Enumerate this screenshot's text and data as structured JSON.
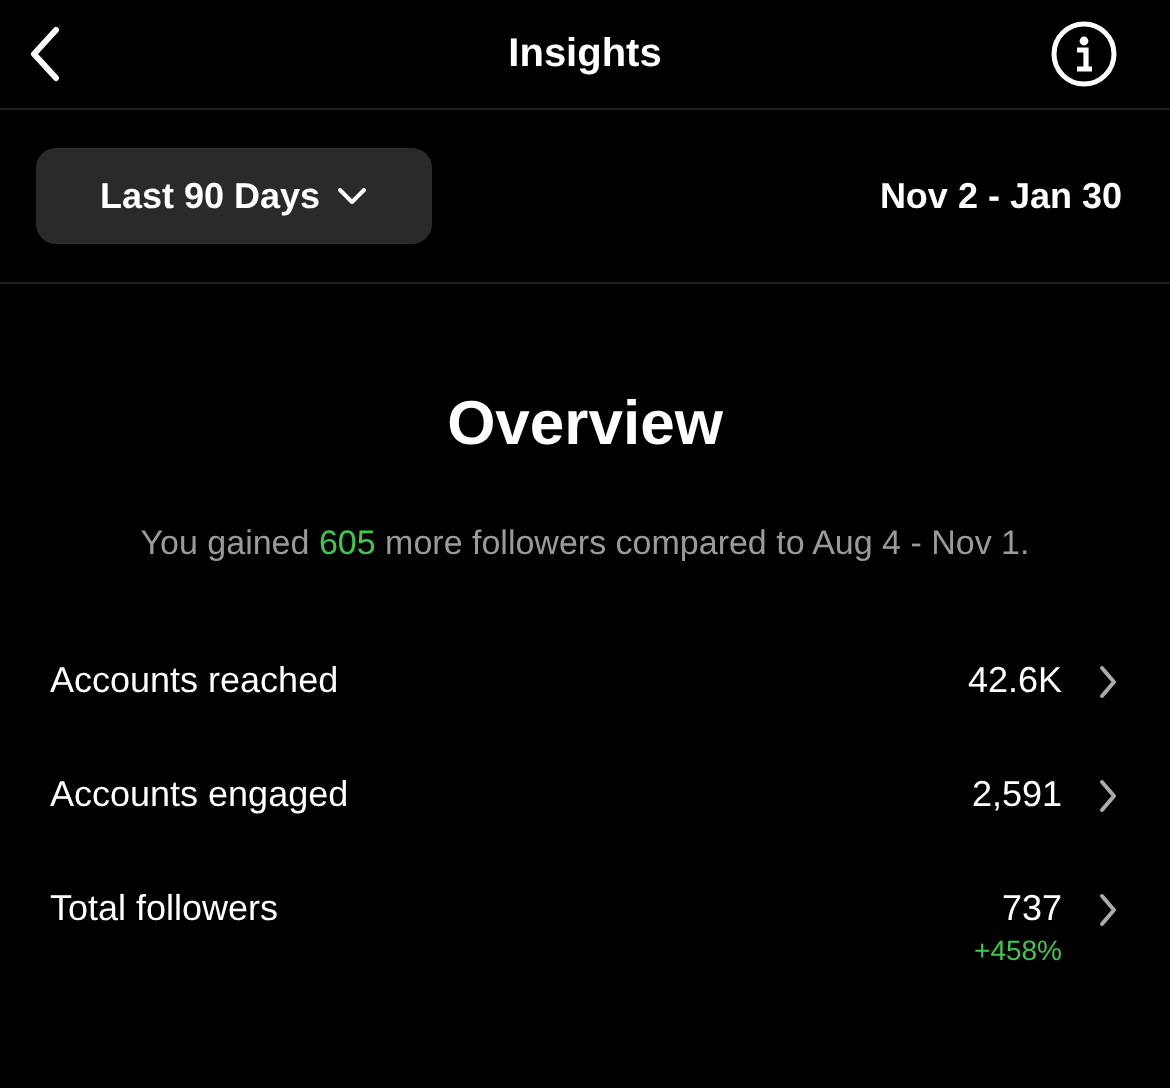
{
  "header": {
    "title": "Insights"
  },
  "range": {
    "label": "Last 90 Days",
    "dates": "Nov 2 - Jan 30"
  },
  "overview": {
    "title": "Overview",
    "before": "You gained ",
    "highlight": "605",
    "after": " more followers compared to Aug 4 - Nov 1."
  },
  "metrics": [
    {
      "label": "Accounts reached",
      "value": "42.6K"
    },
    {
      "label": "Accounts engaged",
      "value": "2,591"
    },
    {
      "label": "Total followers",
      "value": "737",
      "change": "+458%"
    }
  ]
}
